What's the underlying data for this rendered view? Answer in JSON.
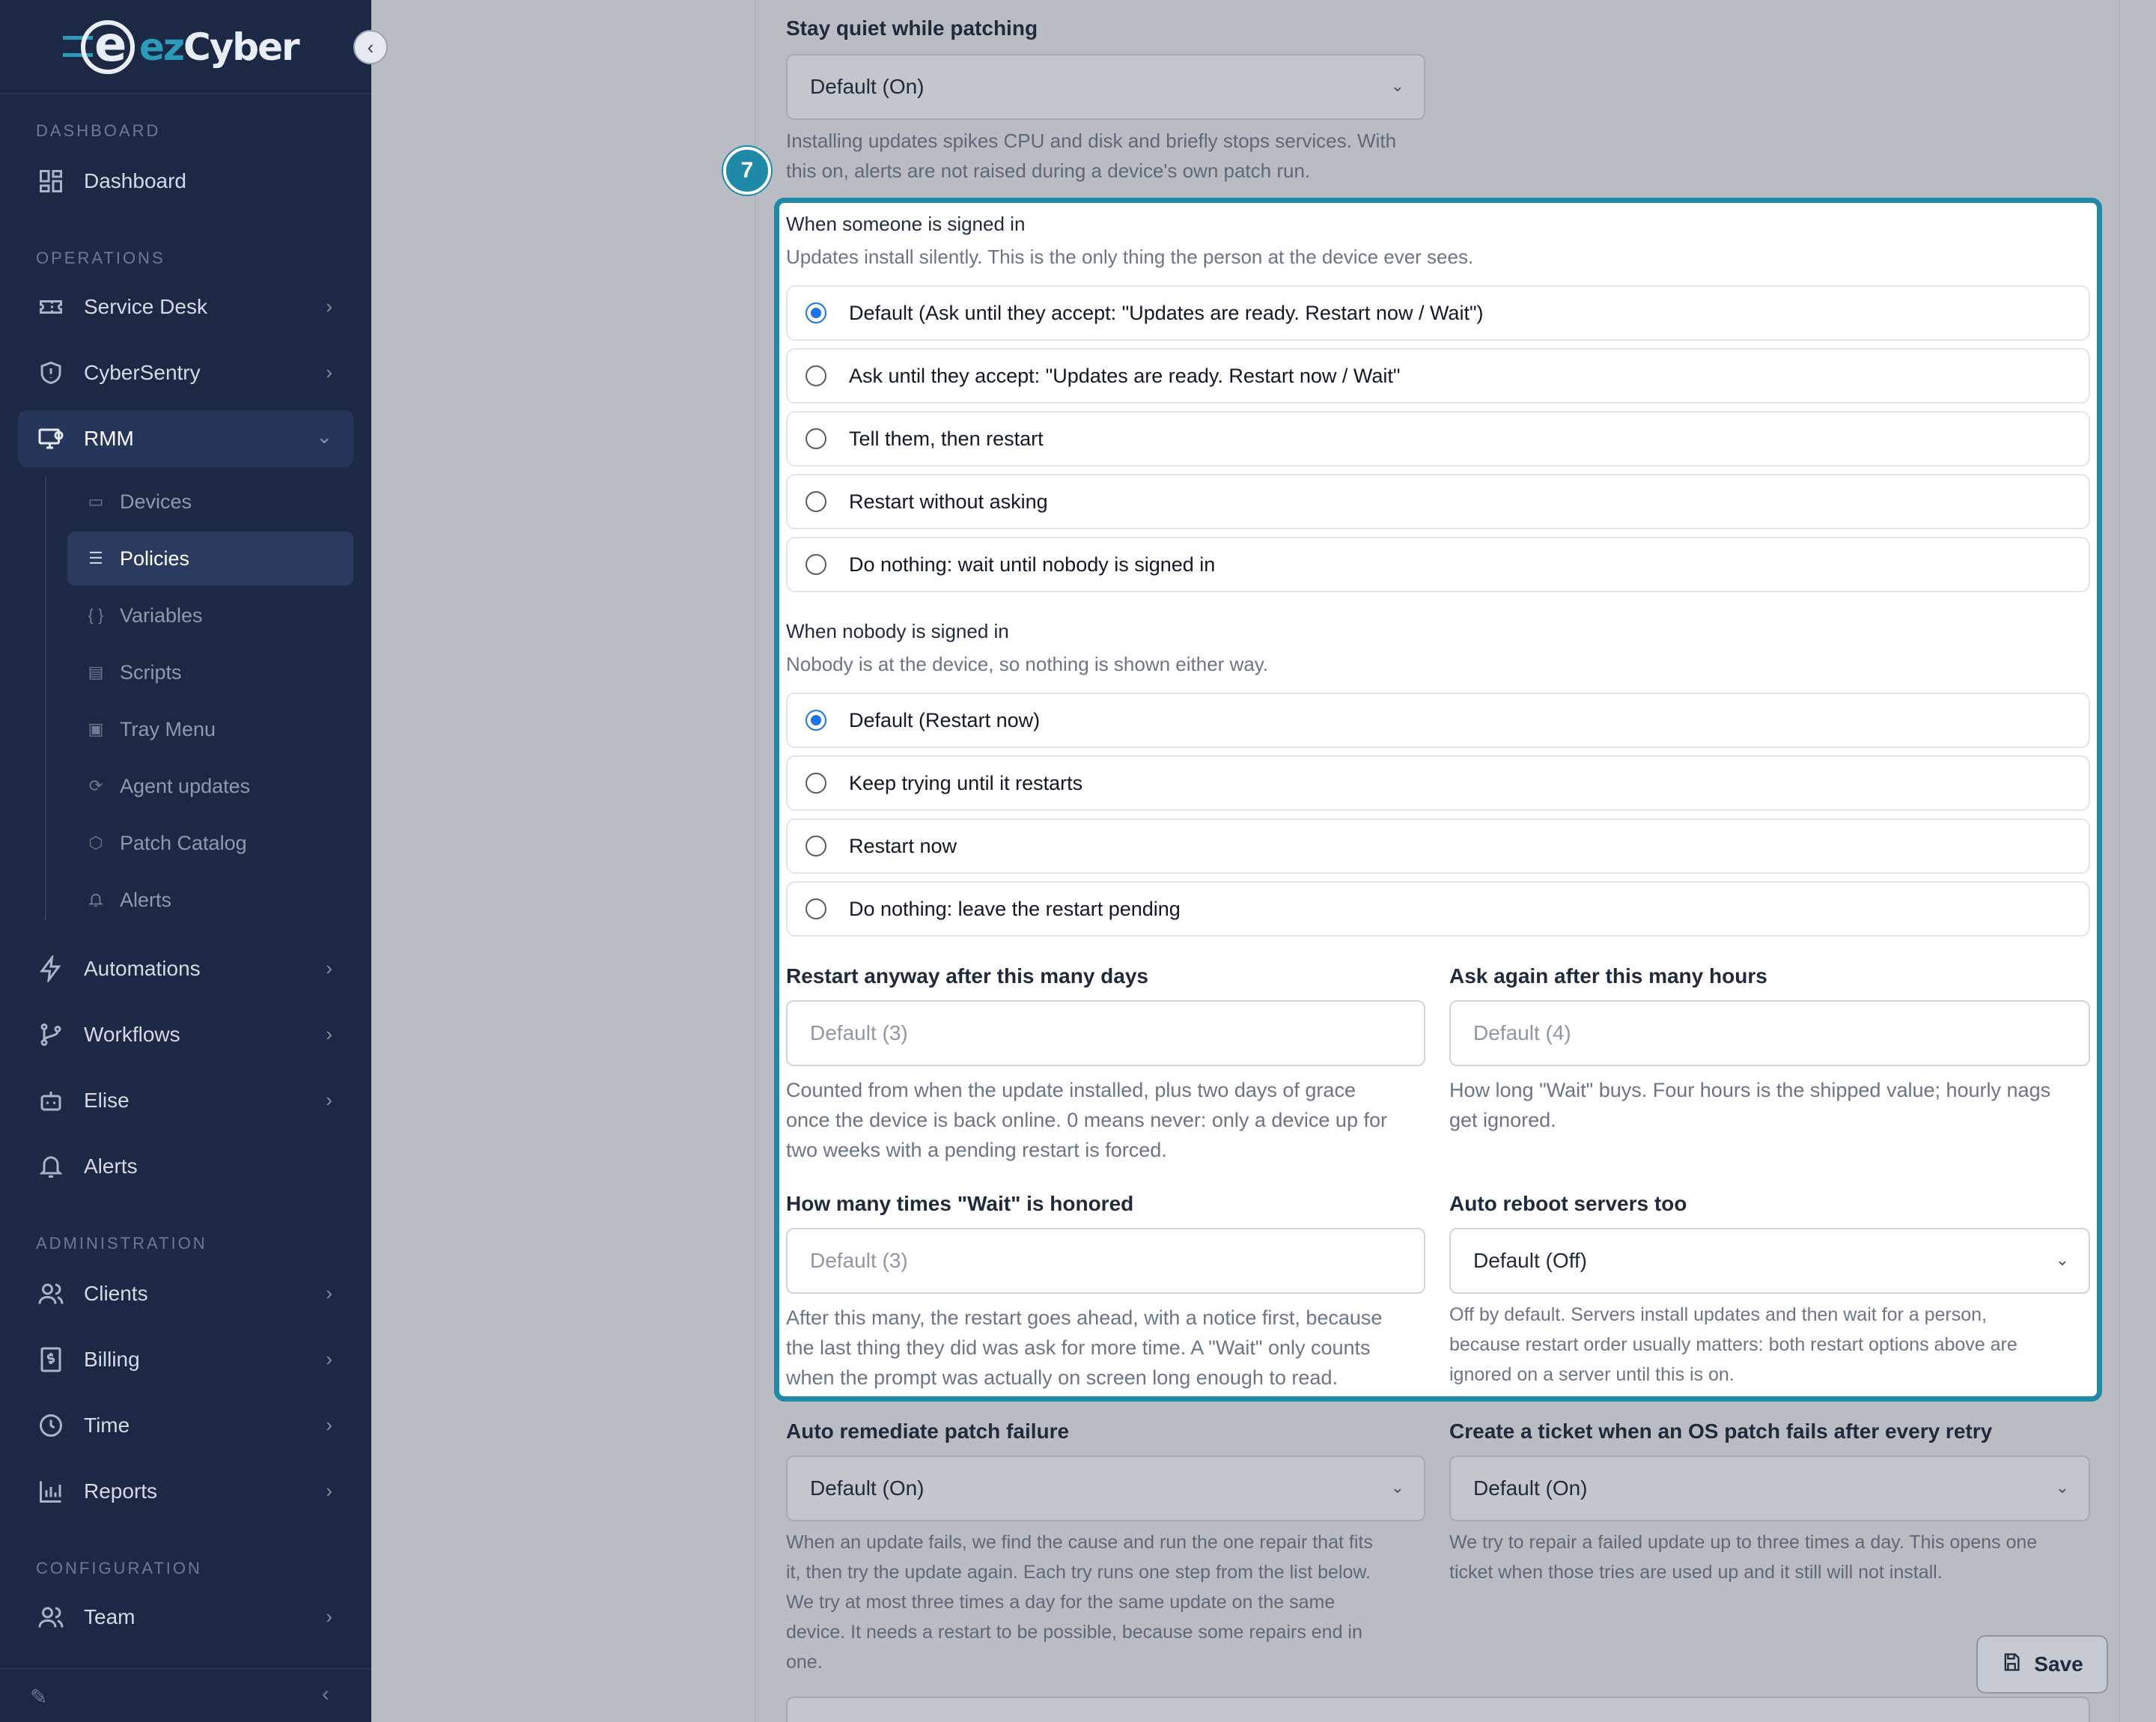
{
  "brand": {
    "prefix": "ez",
    "name": "Cyber"
  },
  "sidebar": {
    "sections": {
      "dashboard": "DASHBOARD",
      "operations": "OPERATIONS",
      "administration": "ADMINISTRATION",
      "configuration": "CONFIGURATION"
    },
    "items": {
      "dashboard": "Dashboard",
      "service_desk": "Service Desk",
      "cybersentry": "CyberSentry",
      "rmm": "RMM",
      "automations": "Automations",
      "workflows": "Workflows",
      "elise": "Elise",
      "alerts": "Alerts",
      "clients": "Clients",
      "billing": "Billing",
      "time": "Time",
      "reports": "Reports",
      "team": "Team"
    },
    "rmm_sub": {
      "devices": "Devices",
      "policies": "Policies",
      "variables": "Variables",
      "scripts": "Scripts",
      "tray_menu": "Tray Menu",
      "agent_updates": "Agent updates",
      "patch_catalog": "Patch Catalog",
      "alerts": "Alerts"
    }
  },
  "form": {
    "stay_quiet": {
      "label": "Stay quiet while patching",
      "value": "Default (On)",
      "help1": "Installing updates spikes CPU and disk and briefly stops services. With",
      "help2": "this on, alerts are not raised during a device's own patch run."
    },
    "step_badge": "7",
    "signed_in": {
      "title": "When someone is signed in",
      "subtitle": "Updates install silently. This is the only thing the person at the device ever sees.",
      "options": [
        "Default (Ask until they accept: \"Updates are ready. Restart now / Wait\")",
        "Ask until they accept: \"Updates are ready. Restart now / Wait\"",
        "Tell them, then restart",
        "Restart without asking",
        "Do nothing: wait until nobody is signed in"
      ],
      "selected": 0
    },
    "nobody_signed_in": {
      "title": "When nobody is signed in",
      "subtitle": "Nobody is at the device, so nothing is shown either way.",
      "options": [
        "Default (Restart now)",
        "Keep trying until it restarts",
        "Restart now",
        "Do nothing: leave the restart pending"
      ],
      "selected": 0
    },
    "restart_days": {
      "label": "Restart anyway after this many days",
      "placeholder": "Default (3)",
      "help1": "Counted from when the update installed, plus two days of grace",
      "help2": "once the device is back online. 0 means never: only a device up for",
      "help3": "two weeks with a pending restart is forced."
    },
    "ask_again": {
      "label": "Ask again after this many hours",
      "placeholder": "Default (4)",
      "help1": "How long \"Wait\" buys. Four hours is the shipped value; hourly nags",
      "help2": "get ignored."
    },
    "wait_count": {
      "label": "How many times \"Wait\" is honored",
      "placeholder": "Default (3)",
      "help1": "After this many, the restart goes ahead, with a notice first, because",
      "help2": "the last thing they did was ask for more time. A \"Wait\" only counts",
      "help3": "when the prompt was actually on screen long enough to read."
    },
    "auto_reboot_servers": {
      "label": "Auto reboot servers too",
      "value": "Default (Off)",
      "help1": "Off by default. Servers install updates and then wait for a person,",
      "help2": "because restart order usually matters: both restart options above are",
      "help3": "ignored on a server until this is on."
    },
    "auto_remediate": {
      "label": "Auto remediate patch failure",
      "value": "Default (On)",
      "help1": "When an update fails, we find the cause and run the one repair that fits",
      "help2": "it, then try the update again. Each try runs one step from the list below.",
      "help3": "We try at most three times a day for the same update on the same",
      "help4": "device. It needs a restart to be possible, because some repairs end in",
      "help5": "one."
    },
    "create_ticket": {
      "label": "Create a ticket when an OS patch fails after every retry",
      "value": "Default (On)",
      "help1": "We try to repair a failed update up to three times a day. This opens one",
      "help2": "ticket when those tries are used up and it still will not install."
    },
    "save_label": "Save"
  }
}
